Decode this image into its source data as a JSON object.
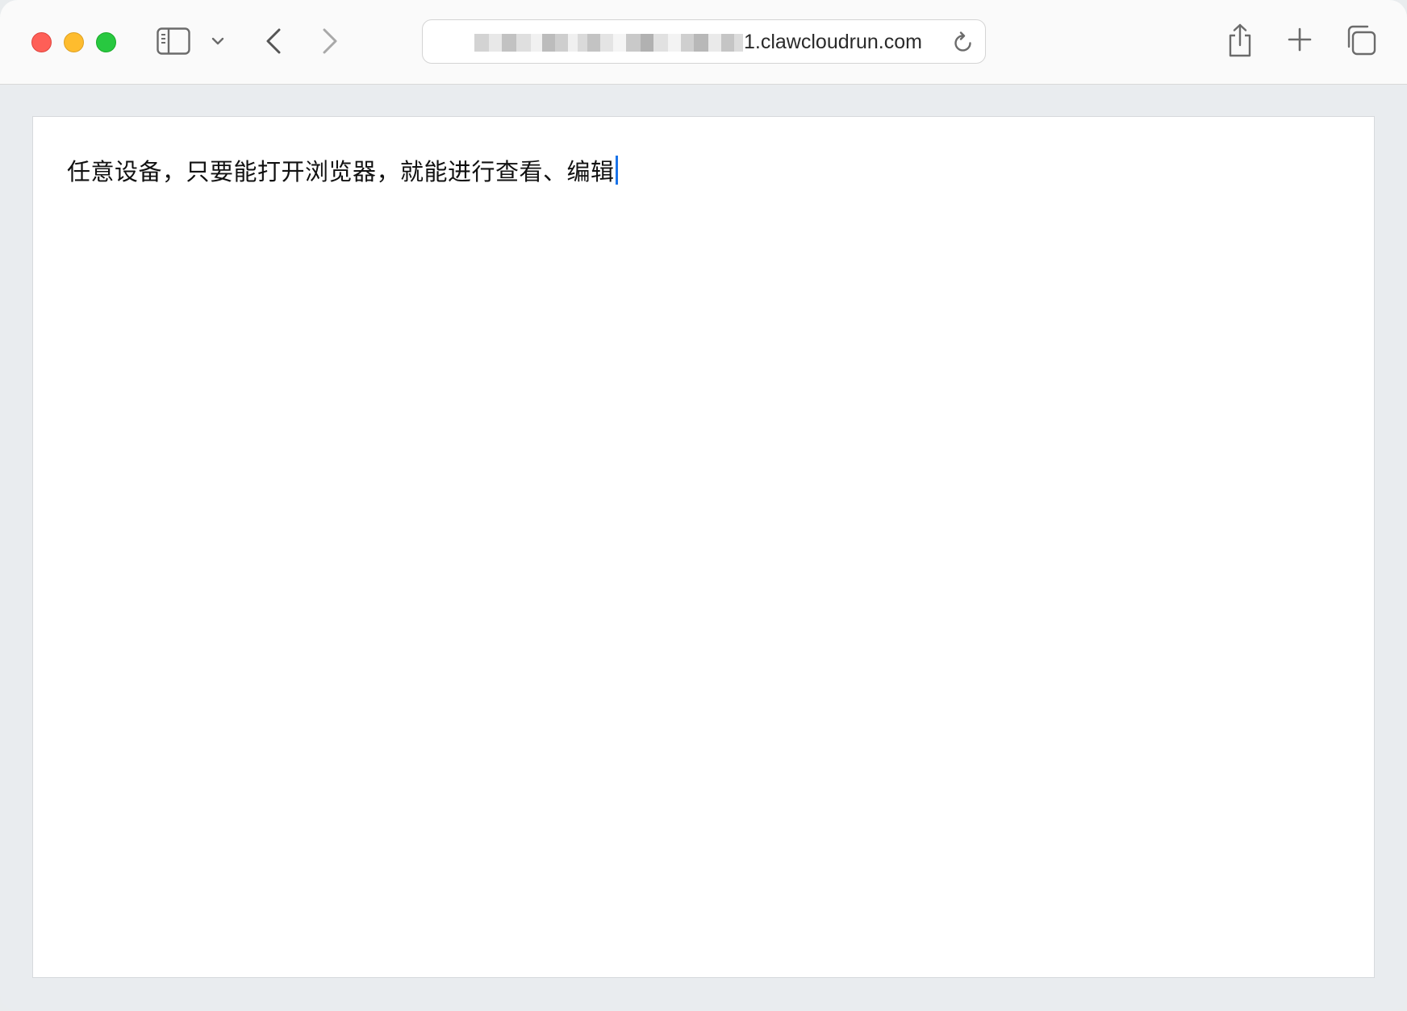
{
  "browser": {
    "address_bar": {
      "url_visible_suffix": "1.clawcloudrun.com"
    },
    "icons": {
      "sidebar": "sidebar-icon",
      "sidebar_menu": "chevron-down-icon",
      "back": "chevron-left-icon",
      "forward": "chevron-right-icon",
      "reload": "reload-icon",
      "share": "share-icon",
      "new_tab": "plus-icon",
      "tab_overview": "tabs-overview-icon"
    },
    "colors": {
      "close": "#fe5f57",
      "minimize": "#febc2e",
      "maximize": "#28c840",
      "caret": "#1a73e8"
    }
  },
  "page": {
    "editor_text": "任意设备，只要能打开浏览器，就能进行查看、编辑"
  }
}
